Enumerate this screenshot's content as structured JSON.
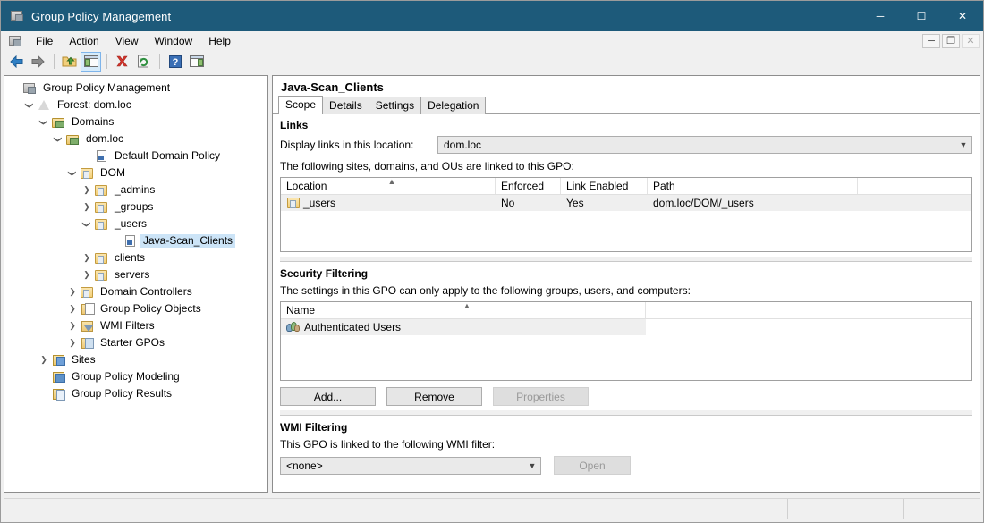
{
  "window": {
    "title": "Group Policy Management",
    "icon": "console-icon",
    "controls": {
      "minimize": "─",
      "maximize": "☐",
      "close": "✕"
    }
  },
  "menubar": {
    "items": [
      "File",
      "Action",
      "View",
      "Window",
      "Help"
    ],
    "mdi_controls": {
      "minimize": "─",
      "restore": "❐",
      "close": "✕"
    }
  },
  "toolbar": {
    "buttons": [
      {
        "name": "back-icon",
        "glyph": "←",
        "state": "enabled"
      },
      {
        "name": "forward-icon",
        "glyph": "→",
        "state": "enabled"
      },
      {
        "name": "up-folder-icon",
        "glyph": "⬆",
        "state": "enabled"
      },
      {
        "name": "show-hide-console-tree-icon",
        "glyph": "▤",
        "state": "selected"
      },
      {
        "name": "delete-icon",
        "glyph": "✕",
        "state": "enabled"
      },
      {
        "name": "refresh-icon",
        "glyph": "↻",
        "state": "enabled"
      },
      {
        "name": "help-icon",
        "glyph": "?",
        "state": "enabled"
      },
      {
        "name": "export-list-icon",
        "glyph": "▥",
        "state": "enabled"
      }
    ]
  },
  "tree": {
    "items": [
      {
        "label": "Group Policy Management",
        "indent": 0,
        "twist": "",
        "icon": "console-icon",
        "selected": false
      },
      {
        "label": "Forest: dom.loc",
        "indent": 1,
        "twist": "v",
        "icon": "forest-icon",
        "selected": false
      },
      {
        "label": "Domains",
        "indent": 2,
        "twist": "v",
        "icon": "domains-icon",
        "selected": false
      },
      {
        "label": "dom.loc",
        "indent": 3,
        "twist": "v",
        "icon": "domain-icon",
        "selected": false
      },
      {
        "label": "Default Domain Policy",
        "indent": 5,
        "twist": "",
        "icon": "gpo-link-icon",
        "selected": false
      },
      {
        "label": "DOM",
        "indent": 4,
        "twist": "v",
        "icon": "ou-folder-icon",
        "selected": false
      },
      {
        "label": "_admins",
        "indent": 5,
        "twist": ">",
        "icon": "ou-folder-icon",
        "selected": false
      },
      {
        "label": "_groups",
        "indent": 5,
        "twist": ">",
        "icon": "ou-folder-icon",
        "selected": false
      },
      {
        "label": "_users",
        "indent": 5,
        "twist": "v",
        "icon": "ou-folder-icon",
        "selected": false
      },
      {
        "label": "Java-Scan_Clients",
        "indent": 7,
        "twist": "",
        "icon": "gpo-link-icon",
        "selected": true
      },
      {
        "label": "clients",
        "indent": 5,
        "twist": ">",
        "icon": "ou-folder-icon",
        "selected": false
      },
      {
        "label": "servers",
        "indent": 5,
        "twist": ">",
        "icon": "ou-folder-icon",
        "selected": false
      },
      {
        "label": "Domain Controllers",
        "indent": 4,
        "twist": ">",
        "icon": "ou-folder-icon",
        "selected": false
      },
      {
        "label": "Group Policy Objects",
        "indent": 4,
        "twist": ">",
        "icon": "group-policy-objects-icon",
        "selected": false
      },
      {
        "label": "WMI Filters",
        "indent": 4,
        "twist": ">",
        "icon": "wmi-filters-icon",
        "selected": false
      },
      {
        "label": "Starter GPOs",
        "indent": 4,
        "twist": ">",
        "icon": "starter-gpos-icon",
        "selected": false
      },
      {
        "label": "Sites",
        "indent": 2,
        "twist": ">",
        "icon": "sites-icon",
        "selected": false
      },
      {
        "label": "Group Policy Modeling",
        "indent": 2,
        "twist": "",
        "icon": "group-policy-modeling-icon",
        "selected": false
      },
      {
        "label": "Group Policy Results",
        "indent": 2,
        "twist": "",
        "icon": "group-policy-results-icon",
        "selected": false
      }
    ]
  },
  "detail": {
    "gpo_name": "Java-Scan_Clients",
    "tabs": [
      {
        "label": "Scope",
        "active": true
      },
      {
        "label": "Details",
        "active": false
      },
      {
        "label": "Settings",
        "active": false
      },
      {
        "label": "Delegation",
        "active": false
      }
    ],
    "links": {
      "heading": "Links",
      "location_label": "Display links in this location:",
      "location_value": "dom.loc",
      "description": "The following sites, domains, and OUs are linked to this GPO:",
      "columns": [
        "Location",
        "Enforced",
        "Link Enabled",
        "Path"
      ],
      "sorted_column": "Location",
      "rows": [
        {
          "location": "_users",
          "enforced": "No",
          "link_enabled": "Yes",
          "path": "dom.loc/DOM/_users",
          "icon": "ou-folder-icon"
        }
      ]
    },
    "security_filtering": {
      "heading": "Security Filtering",
      "description": "The settings in this GPO can only apply to the following groups, users, and computers:",
      "columns": [
        "Name"
      ],
      "rows": [
        {
          "name": "Authenticated Users",
          "icon": "users-group-icon"
        }
      ],
      "buttons": [
        {
          "label": "Add...",
          "enabled": true
        },
        {
          "label": "Remove",
          "enabled": true
        },
        {
          "label": "Properties",
          "enabled": false
        }
      ]
    },
    "wmi_filtering": {
      "heading": "WMI Filtering",
      "description": "This GPO is linked to the following WMI filter:",
      "selected_filter": "<none>",
      "open_button": {
        "label": "Open",
        "enabled": false
      }
    }
  },
  "statusbar": {
    "cells": [
      "",
      "",
      ""
    ]
  },
  "colors": {
    "titlebar": "#1d5a7a",
    "selection": "#cce4f7",
    "toolbar_selected": "#d6ebfa",
    "panel_bg": "#f0f0f0"
  }
}
